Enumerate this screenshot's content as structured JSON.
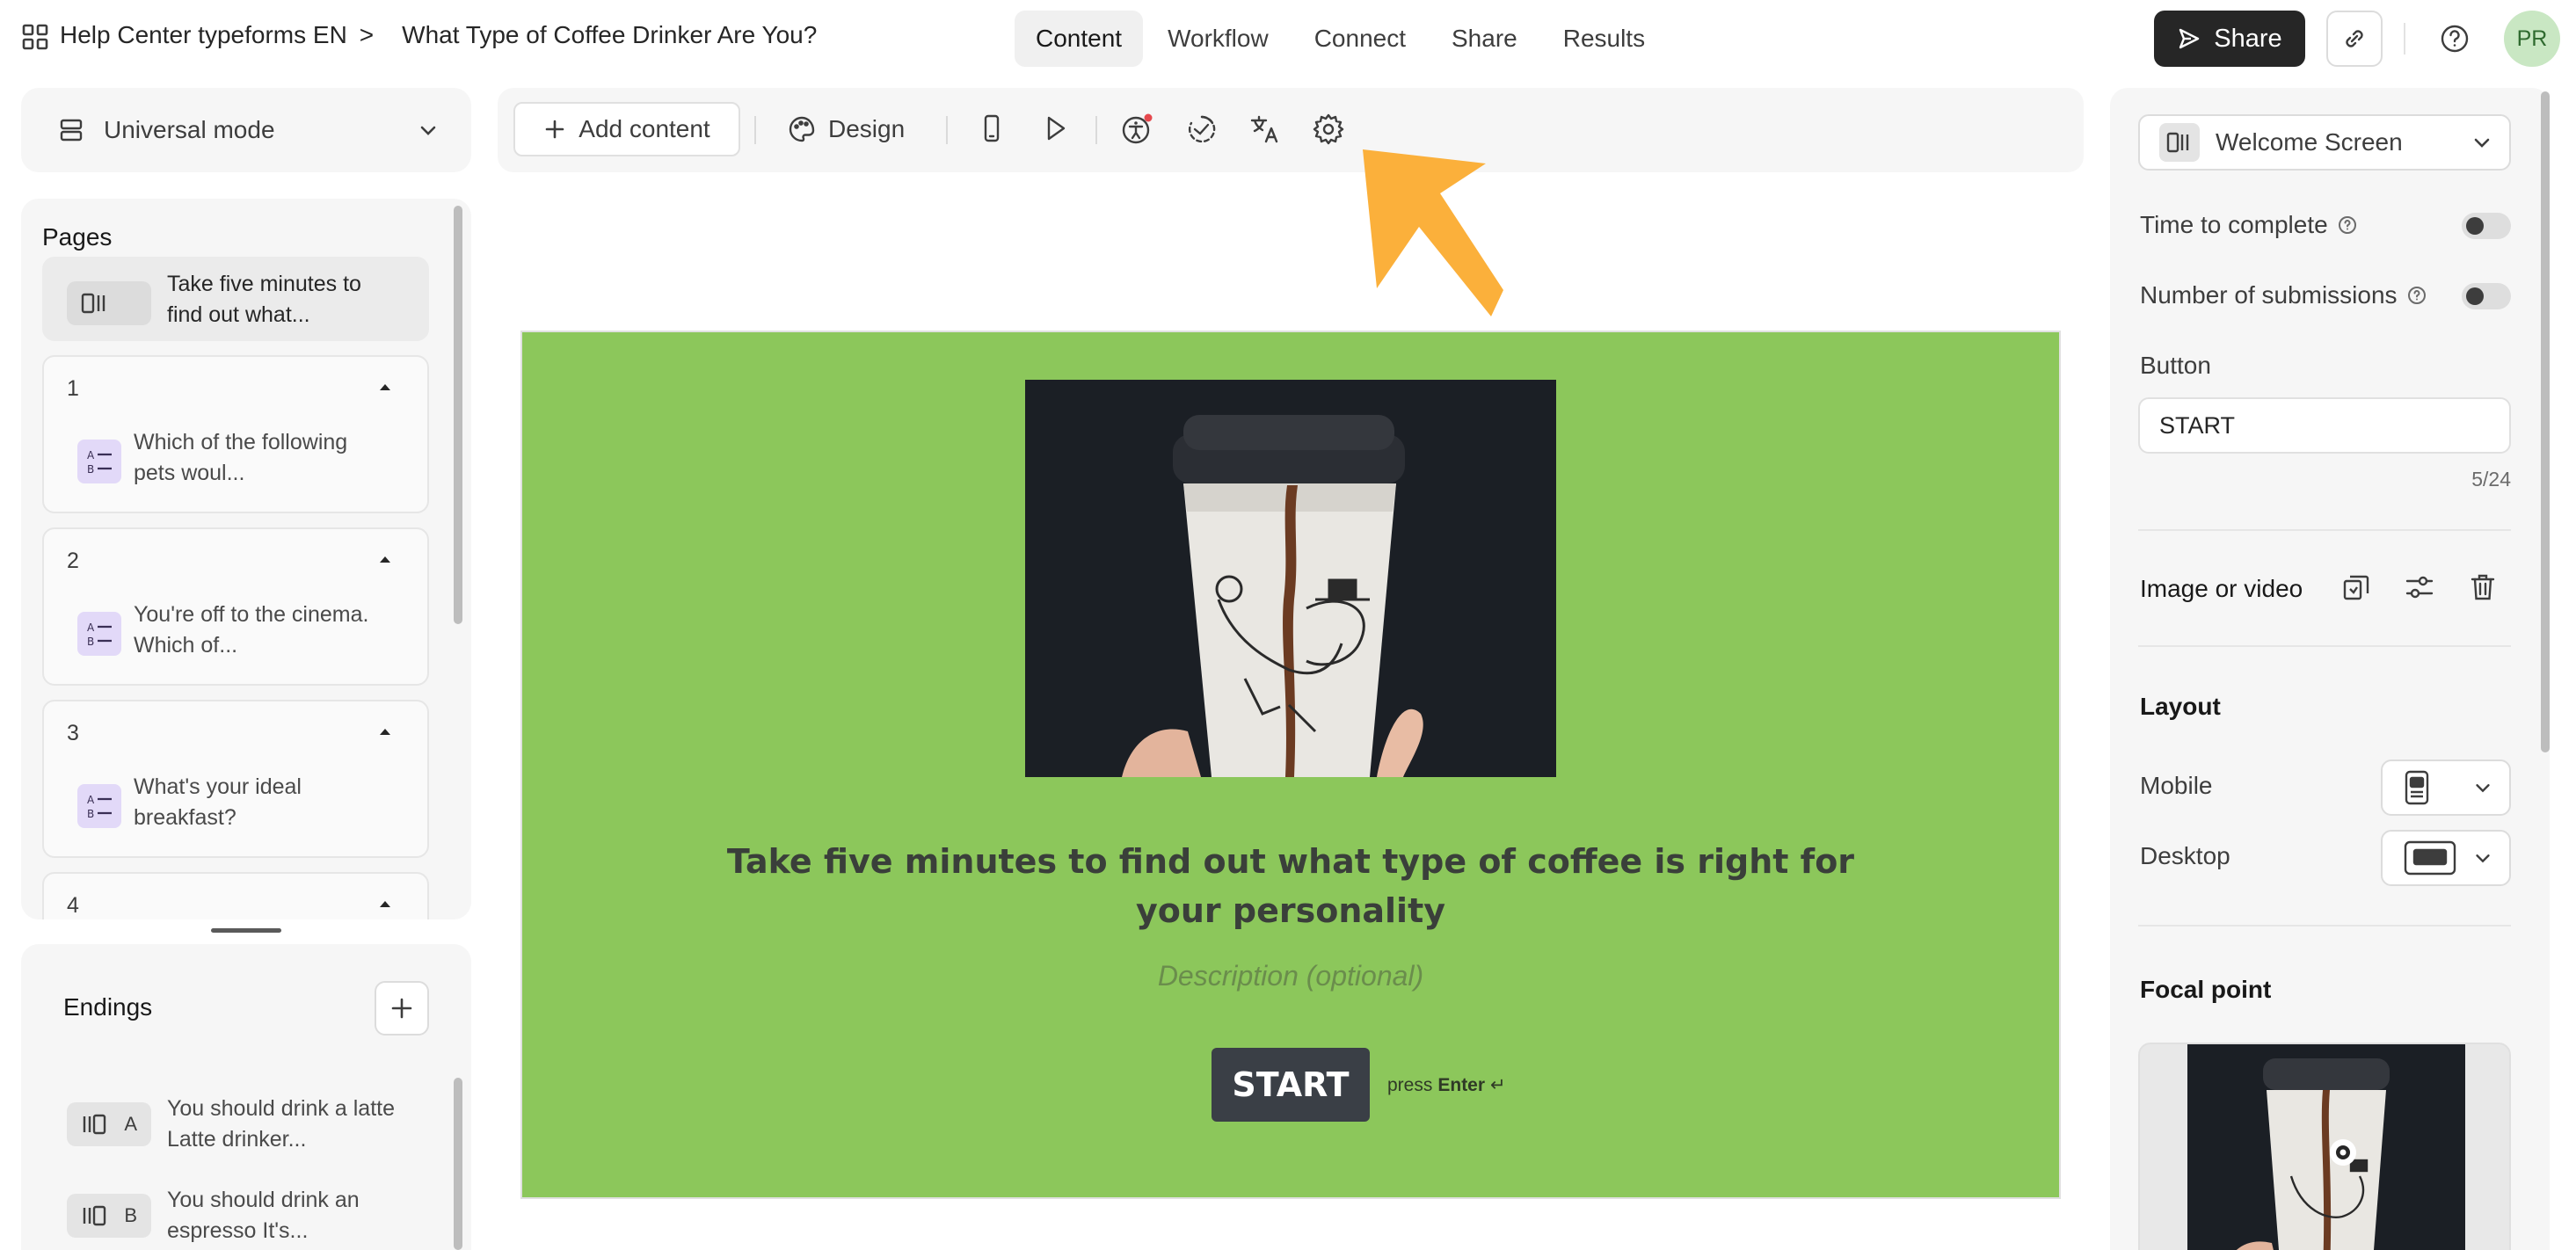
{
  "topbar": {
    "workspace": "Help Center typeforms EN",
    "separator": ">",
    "form_title": "What Type of Coffee Drinker Are You?",
    "tabs": [
      "Content",
      "Workflow",
      "Connect",
      "Share",
      "Results"
    ],
    "active_tab": "Content",
    "share_label": "Share",
    "avatar_initials": "PR"
  },
  "left": {
    "mode_label": "Universal mode",
    "pages_title": "Pages",
    "welcome_page_text": "Take five minutes to find out what...",
    "pages": [
      {
        "num": "1",
        "text": "Which of the following pets woul..."
      },
      {
        "num": "2",
        "text": "You're off to the cinema. Which of..."
      },
      {
        "num": "3",
        "text": "What's your ideal breakfast?"
      },
      {
        "num": "4",
        "text": ""
      }
    ],
    "endings_title": "Endings",
    "endings": [
      {
        "letter": "A",
        "text": "You should drink a latte Latte drinker..."
      },
      {
        "letter": "B",
        "text": "You should drink an espresso It's..."
      }
    ]
  },
  "toolbar": {
    "add_content_label": "Add content",
    "design_label": "Design"
  },
  "canvas": {
    "headline": "Take five minutes to find out what type of coffee is right for your personality",
    "description_placeholder": "Description (optional)",
    "button_label": "START",
    "press_label": "press",
    "enter_label": "Enter",
    "enter_symbol": "↵",
    "bg_color": "#8cc75b"
  },
  "right": {
    "screen_type": "Welcome Screen",
    "time_to_complete": "Time to complete",
    "num_submissions": "Number of submissions",
    "button_section": "Button",
    "button_value": "START",
    "char_count": "5/24",
    "image_or_video": "Image or video",
    "layout_title": "Layout",
    "mobile_label": "Mobile",
    "desktop_label": "Desktop",
    "focal_point_title": "Focal point"
  },
  "annotation": {
    "color": "#fbb03b"
  }
}
